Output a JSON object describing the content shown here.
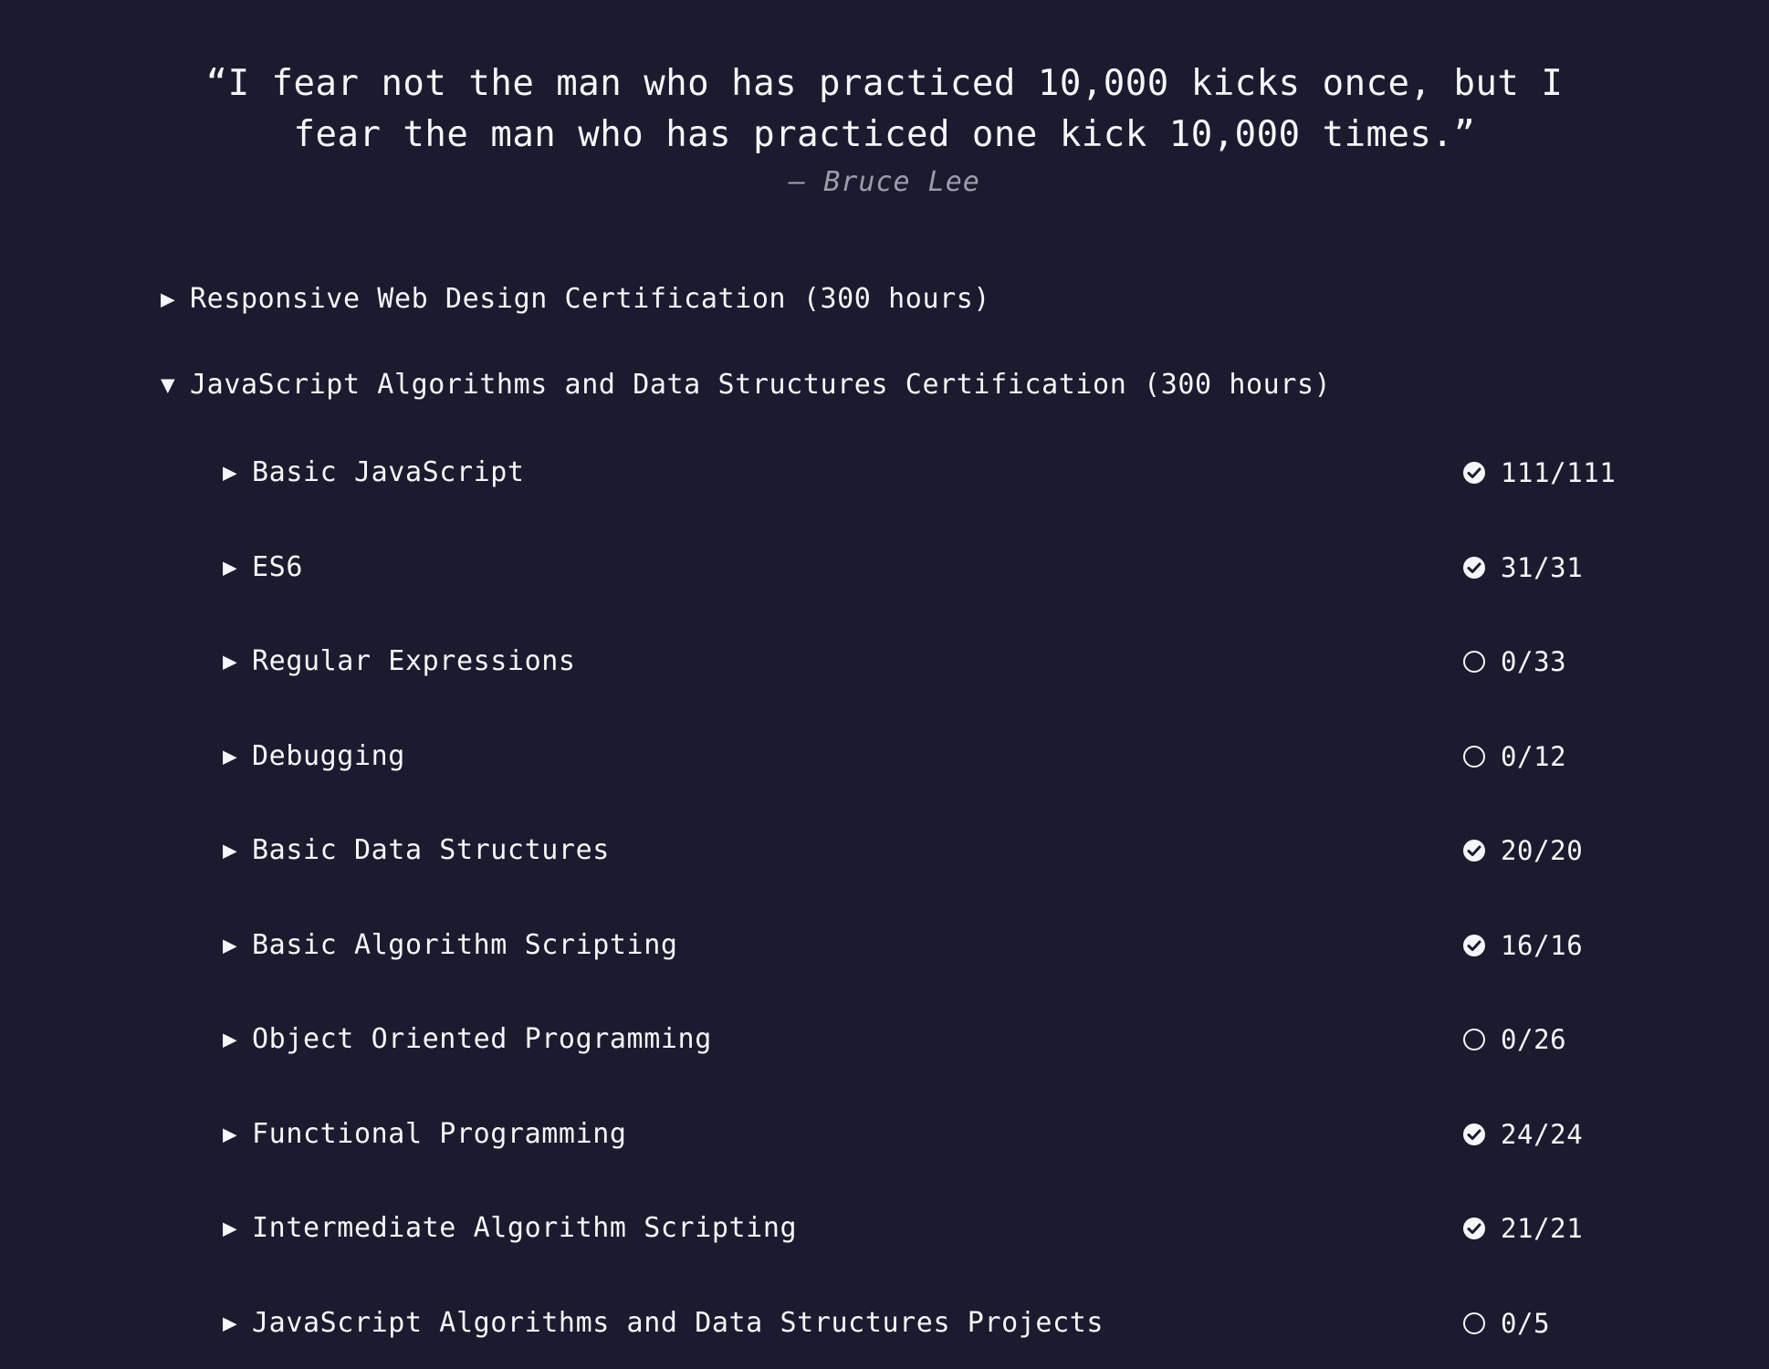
{
  "quote": {
    "text": "“I fear not the man who has practiced 10,000 kicks once, but I fear the man who has practiced one kick 10,000 times.”",
    "author": "— Bruce Lee"
  },
  "certifications": [
    {
      "label": "Responsive Web Design Certification (300 hours)",
      "arrow": "▶",
      "expanded": false
    },
    {
      "label": "JavaScript Algorithms and Data Structures Certification (300 hours)",
      "arrow": "▼",
      "expanded": true
    }
  ],
  "superblocks": [
    {
      "arrow": "▶",
      "title": "Basic JavaScript",
      "progress": "111/111",
      "status": "complete"
    },
    {
      "arrow": "▶",
      "title": "ES6",
      "progress": "31/31",
      "status": "complete"
    },
    {
      "arrow": "▶",
      "title": "Regular Expressions",
      "progress": "0/33",
      "status": "incomplete"
    },
    {
      "arrow": "▶",
      "title": "Debugging",
      "progress": "0/12",
      "status": "incomplete"
    },
    {
      "arrow": "▶",
      "title": "Basic Data Structures",
      "progress": "20/20",
      "status": "complete"
    },
    {
      "arrow": "▶",
      "title": "Basic Algorithm Scripting",
      "progress": "16/16",
      "status": "complete"
    },
    {
      "arrow": "▶",
      "title": "Object Oriented Programming",
      "progress": "0/26",
      "status": "incomplete"
    },
    {
      "arrow": "▶",
      "title": "Functional Programming",
      "progress": "24/24",
      "status": "complete"
    },
    {
      "arrow": "▶",
      "title": "Intermediate Algorithm Scripting",
      "progress": "21/21",
      "status": "complete"
    },
    {
      "arrow": "▶",
      "title": "JavaScript Algorithms and Data Structures Projects",
      "progress": "0/5",
      "status": "incomplete"
    }
  ],
  "colors": {
    "background": "#1b1b2f",
    "text": "#f5f6f7",
    "muted": "#9d9daa"
  },
  "icons": {
    "complete": "check-circle-icon",
    "incomplete": "empty-circle-icon",
    "collapsed": "caret-right-icon",
    "expanded": "caret-down-icon"
  }
}
